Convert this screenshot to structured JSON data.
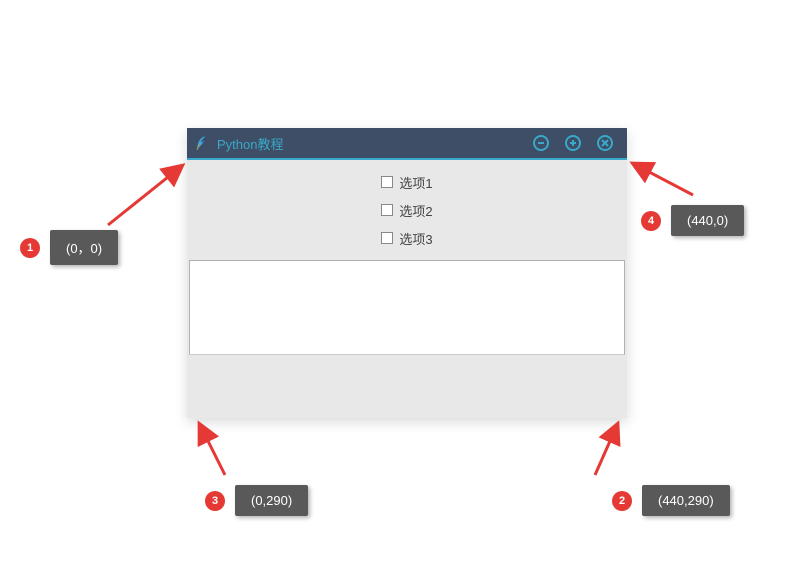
{
  "window": {
    "title": "Python教程",
    "checkboxes": [
      {
        "label": "选项1",
        "checked": false
      },
      {
        "label": "选项2",
        "checked": false
      },
      {
        "label": "选项3",
        "checked": false
      }
    ]
  },
  "annotations": [
    {
      "num": "1",
      "coord": "(0，0)"
    },
    {
      "num": "2",
      "coord": "(440,290)"
    },
    {
      "num": "3",
      "coord": "(0,290)"
    },
    {
      "num": "4",
      "coord": "(440,0)"
    }
  ],
  "icons": {
    "minimize": "−",
    "maximize": "+",
    "close": "×"
  }
}
